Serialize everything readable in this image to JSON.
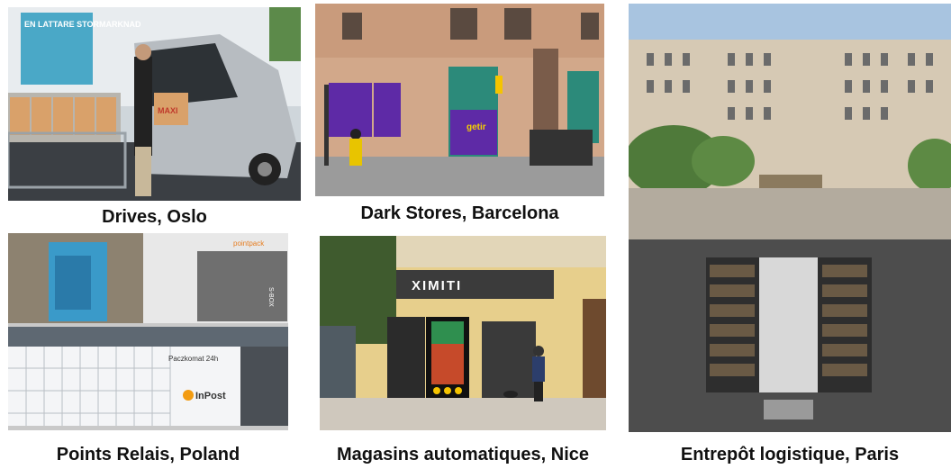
{
  "photos": [
    {
      "caption": "Drives, Oslo",
      "signage": {
        "banner": "EN LATTARE STORMARKNAD",
        "bag": "MAXI"
      }
    },
    {
      "caption": "Dark Stores, Barcelona",
      "signage": {
        "shop": "getir"
      }
    },
    {
      "caption": "Points Relais,  Poland",
      "signage": {
        "locker_brand": "InPost",
        "locker_label": "Paczkomat 24h",
        "pack": "pointpack",
        "sbox": "S-BOX"
      }
    },
    {
      "caption": "Magasins automatiques, Nice",
      "signage": {
        "store": "XIMITI"
      }
    },
    {
      "caption": "Entrepôt logistique, Paris",
      "signage": {}
    }
  ]
}
